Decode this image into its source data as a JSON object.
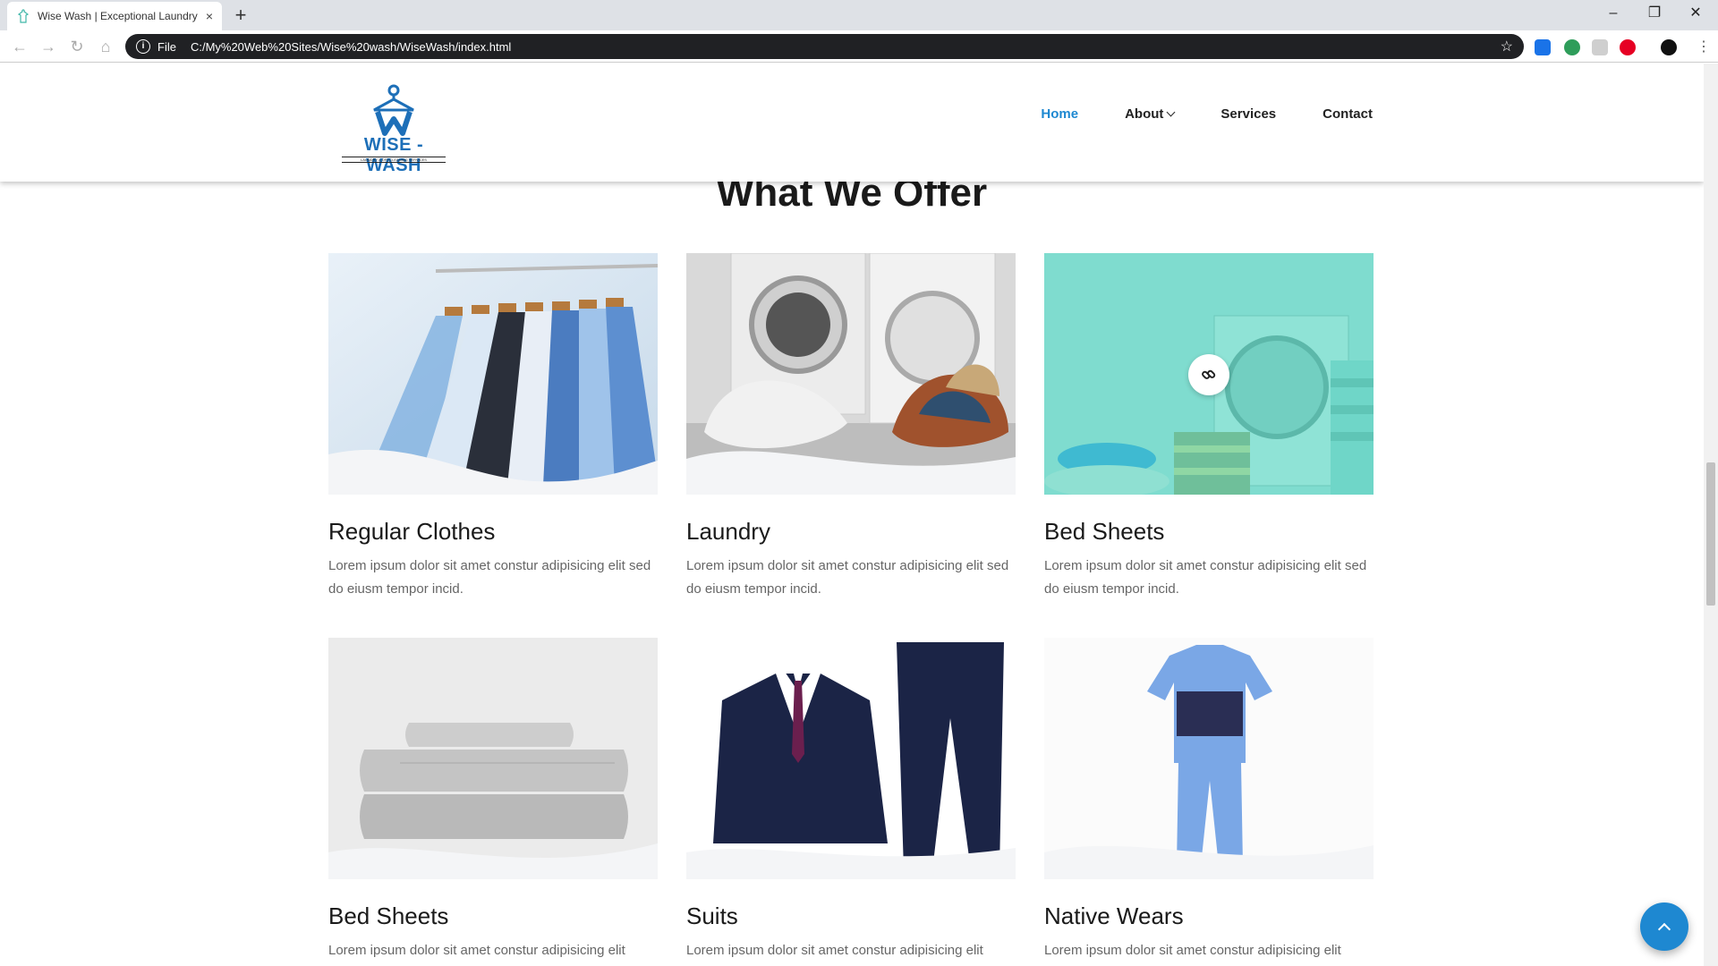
{
  "browser": {
    "tab_title": "Wise Wash | Exceptional Laundry",
    "tab_close": "×",
    "new_tab": "+",
    "scheme_label": "File",
    "url": "C:/My%20Web%20Sites/Wise%20wash/WiseWash/index.html"
  },
  "site": {
    "logo_text": "WISE - WASH",
    "logo_tagline": "LAUNDRY & DRYCLEANING SERVICES",
    "accent_color": "#1e88d1",
    "nav": [
      {
        "label": "Home",
        "active": true
      },
      {
        "label": "About",
        "has_dropdown": true
      },
      {
        "label": "Services"
      },
      {
        "label": "Contact"
      }
    ]
  },
  "offer": {
    "title": "What We Offer",
    "cards": [
      {
        "title": "Regular Clothes",
        "text": "Lorem ipsum dolor sit amet constur adipisicing elit sed do eiusm tempor incid.",
        "image": "shirts-on-hangers"
      },
      {
        "title": "Laundry",
        "text": "Lorem ipsum dolor sit amet constur adipisicing elit sed do eiusm tempor incid.",
        "image": "washing-machines-with-laundry"
      },
      {
        "title": "Bed Sheets",
        "text": "Lorem ipsum dolor sit amet constur adipisicing elit sed do eiusm tempor incid.",
        "image": "teal-overlay-towels",
        "hover_icon": "link-icon"
      },
      {
        "title": "Bed Sheets",
        "text": "Lorem ipsum dolor sit amet constur adipisicing elit",
        "image": "folded-grey-sheets"
      },
      {
        "title": "Suits",
        "text": "Lorem ipsum dolor sit amet constur adipisicing elit",
        "image": "navy-suit"
      },
      {
        "title": "Native Wears",
        "text": "Lorem ipsum dolor sit amet constur adipisicing elit",
        "image": "blue-native-wear"
      }
    ]
  },
  "back_to_top_icon": "chevron-up-icon"
}
